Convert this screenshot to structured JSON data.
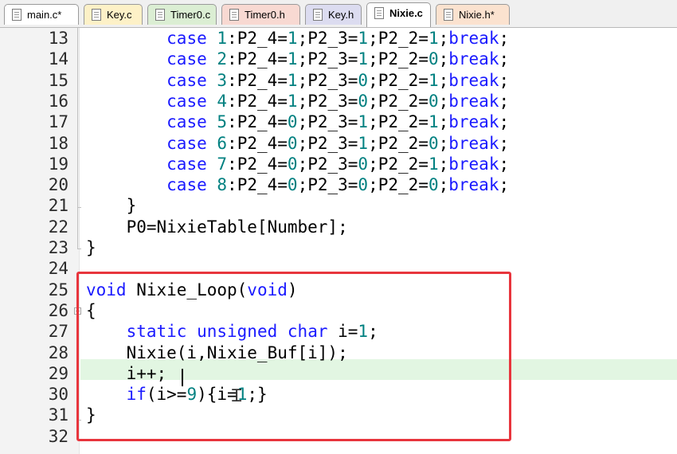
{
  "tabs": [
    {
      "label": "main.c*",
      "color": "#ffffff",
      "active": false
    },
    {
      "label": "Key.c",
      "color": "#fdf1c7",
      "active": false
    },
    {
      "label": "Timer0.c",
      "color": "#dbeed3",
      "active": false
    },
    {
      "label": "Timer0.h",
      "color": "#f8d9d2",
      "active": false
    },
    {
      "label": "Key.h",
      "color": "#dcdcf0",
      "active": false
    },
    {
      "label": "Nixie.c",
      "color": "#ffffff",
      "active": true
    },
    {
      "label": "Nixie.h*",
      "color": "#fbe2cf",
      "active": false
    }
  ],
  "editor": {
    "highlighted_line": "29",
    "lines": [
      {
        "num": "13",
        "parts": [
          {
            "t": "        "
          },
          {
            "t": "case",
            "k": "kw"
          },
          {
            "t": " "
          },
          {
            "t": "1",
            "k": "num"
          },
          {
            "t": ":P2_4="
          },
          {
            "t": "1",
            "k": "num"
          },
          {
            "t": ";P2_3="
          },
          {
            "t": "1",
            "k": "num"
          },
          {
            "t": ";P2_2="
          },
          {
            "t": "1",
            "k": "num"
          },
          {
            "t": ";"
          },
          {
            "t": "break",
            "k": "kw"
          },
          {
            "t": ";"
          }
        ]
      },
      {
        "num": "14",
        "parts": [
          {
            "t": "        "
          },
          {
            "t": "case",
            "k": "kw"
          },
          {
            "t": " "
          },
          {
            "t": "2",
            "k": "num"
          },
          {
            "t": ":P2_4="
          },
          {
            "t": "1",
            "k": "num"
          },
          {
            "t": ";P2_3="
          },
          {
            "t": "1",
            "k": "num"
          },
          {
            "t": ";P2_2="
          },
          {
            "t": "0",
            "k": "num"
          },
          {
            "t": ";"
          },
          {
            "t": "break",
            "k": "kw"
          },
          {
            "t": ";"
          }
        ]
      },
      {
        "num": "15",
        "parts": [
          {
            "t": "        "
          },
          {
            "t": "case",
            "k": "kw"
          },
          {
            "t": " "
          },
          {
            "t": "3",
            "k": "num"
          },
          {
            "t": ":P2_4="
          },
          {
            "t": "1",
            "k": "num"
          },
          {
            "t": ";P2_3="
          },
          {
            "t": "0",
            "k": "num"
          },
          {
            "t": ";P2_2="
          },
          {
            "t": "1",
            "k": "num"
          },
          {
            "t": ";"
          },
          {
            "t": "break",
            "k": "kw"
          },
          {
            "t": ";"
          }
        ]
      },
      {
        "num": "16",
        "parts": [
          {
            "t": "        "
          },
          {
            "t": "case",
            "k": "kw"
          },
          {
            "t": " "
          },
          {
            "t": "4",
            "k": "num"
          },
          {
            "t": ":P2_4="
          },
          {
            "t": "1",
            "k": "num"
          },
          {
            "t": ";P2_3="
          },
          {
            "t": "0",
            "k": "num"
          },
          {
            "t": ";P2_2="
          },
          {
            "t": "0",
            "k": "num"
          },
          {
            "t": ";"
          },
          {
            "t": "break",
            "k": "kw"
          },
          {
            "t": ";"
          }
        ]
      },
      {
        "num": "17",
        "parts": [
          {
            "t": "        "
          },
          {
            "t": "case",
            "k": "kw"
          },
          {
            "t": " "
          },
          {
            "t": "5",
            "k": "num"
          },
          {
            "t": ":P2_4="
          },
          {
            "t": "0",
            "k": "num"
          },
          {
            "t": ";P2_3="
          },
          {
            "t": "1",
            "k": "num"
          },
          {
            "t": ";P2_2="
          },
          {
            "t": "1",
            "k": "num"
          },
          {
            "t": ";"
          },
          {
            "t": "break",
            "k": "kw"
          },
          {
            "t": ";"
          }
        ]
      },
      {
        "num": "18",
        "parts": [
          {
            "t": "        "
          },
          {
            "t": "case",
            "k": "kw"
          },
          {
            "t": " "
          },
          {
            "t": "6",
            "k": "num"
          },
          {
            "t": ":P2_4="
          },
          {
            "t": "0",
            "k": "num"
          },
          {
            "t": ";P2_3="
          },
          {
            "t": "1",
            "k": "num"
          },
          {
            "t": ";P2_2="
          },
          {
            "t": "0",
            "k": "num"
          },
          {
            "t": ";"
          },
          {
            "t": "break",
            "k": "kw"
          },
          {
            "t": ";"
          }
        ]
      },
      {
        "num": "19",
        "parts": [
          {
            "t": "        "
          },
          {
            "t": "case",
            "k": "kw"
          },
          {
            "t": " "
          },
          {
            "t": "7",
            "k": "num"
          },
          {
            "t": ":P2_4="
          },
          {
            "t": "0",
            "k": "num"
          },
          {
            "t": ";P2_3="
          },
          {
            "t": "0",
            "k": "num"
          },
          {
            "t": ";P2_2="
          },
          {
            "t": "1",
            "k": "num"
          },
          {
            "t": ";"
          },
          {
            "t": "break",
            "k": "kw"
          },
          {
            "t": ";"
          }
        ]
      },
      {
        "num": "20",
        "parts": [
          {
            "t": "        "
          },
          {
            "t": "case",
            "k": "kw"
          },
          {
            "t": " "
          },
          {
            "t": "8",
            "k": "num"
          },
          {
            "t": ":P2_4="
          },
          {
            "t": "0",
            "k": "num"
          },
          {
            "t": ";P2_3="
          },
          {
            "t": "0",
            "k": "num"
          },
          {
            "t": ";P2_2="
          },
          {
            "t": "0",
            "k": "num"
          },
          {
            "t": ";"
          },
          {
            "t": "break",
            "k": "kw"
          },
          {
            "t": ";"
          }
        ]
      },
      {
        "num": "21",
        "parts": [
          {
            "t": "    }"
          }
        ]
      },
      {
        "num": "22",
        "parts": [
          {
            "t": "    P0=NixieTable[Number];"
          }
        ]
      },
      {
        "num": "23",
        "parts": [
          {
            "t": "}"
          }
        ]
      },
      {
        "num": "24",
        "parts": []
      },
      {
        "num": "25",
        "parts": [
          {
            "t": "void",
            "k": "kw"
          },
          {
            "t": " Nixie_Loop("
          },
          {
            "t": "void",
            "k": "kw"
          },
          {
            "t": ")"
          }
        ]
      },
      {
        "num": "26",
        "parts": [
          {
            "t": "{"
          }
        ]
      },
      {
        "num": "27",
        "parts": [
          {
            "t": "    "
          },
          {
            "t": "static",
            "k": "kw"
          },
          {
            "t": " "
          },
          {
            "t": "unsigned",
            "k": "kw"
          },
          {
            "t": " "
          },
          {
            "t": "char",
            "k": "kw"
          },
          {
            "t": " i="
          },
          {
            "t": "1",
            "k": "num"
          },
          {
            "t": ";"
          }
        ]
      },
      {
        "num": "28",
        "parts": [
          {
            "t": "    Nixie(i,Nixie_Buf[i]);"
          }
        ]
      },
      {
        "num": "29",
        "parts": [
          {
            "t": "    i++;"
          }
        ]
      },
      {
        "num": "30",
        "parts": [
          {
            "t": "    "
          },
          {
            "t": "if",
            "k": "kw"
          },
          {
            "t": "(i>="
          },
          {
            "t": "9",
            "k": "num"
          },
          {
            "t": ")"
          },
          {
            "t": "{",
            "k": "pn"
          },
          {
            "t": "i="
          },
          {
            "t": "1",
            "k": "num"
          },
          {
            "t": ";}"
          }
        ]
      },
      {
        "num": "31",
        "parts": [
          {
            "t": "}"
          }
        ]
      },
      {
        "num": "32",
        "parts": []
      }
    ]
  },
  "fold_marker": "−",
  "colors": {
    "keyword": "#1a1aff",
    "number": "#008080",
    "highlight_box": "#e8353d",
    "current_line": "#e2f6e2"
  }
}
